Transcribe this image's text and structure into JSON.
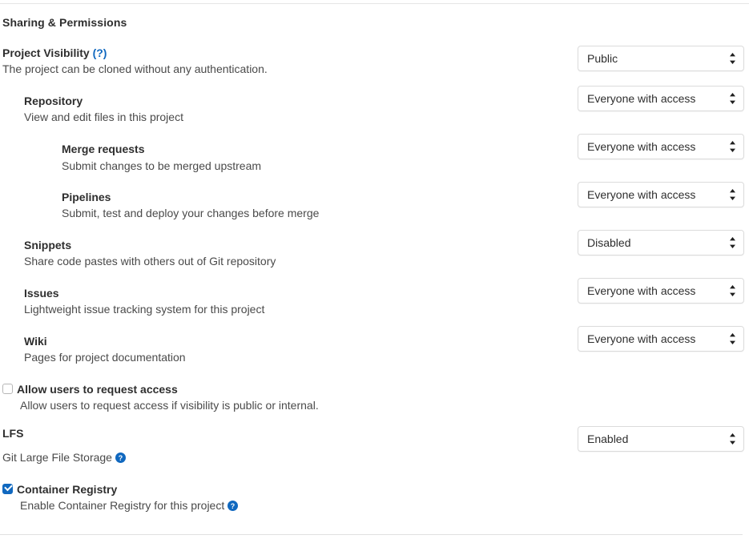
{
  "section": {
    "title": "Sharing & Permissions"
  },
  "visibility": {
    "label": "Project Visibility",
    "help_link": "(?)",
    "description": "The project can be cloned without any authentication.",
    "select_value": "Public"
  },
  "features": [
    {
      "label": "Repository",
      "description": "View and edit files in this project",
      "select_value": "Everyone with access",
      "indent": 30
    },
    {
      "label": "Merge requests",
      "description": "Submit changes to be merged upstream",
      "select_value": "Everyone with access",
      "indent": 77
    },
    {
      "label": "Pipelines",
      "description": "Submit, test and deploy your changes before merge",
      "select_value": "Everyone with access",
      "indent": 77
    },
    {
      "label": "Snippets",
      "description": "Share code pastes with others out of Git repository",
      "select_value": "Disabled",
      "indent": 30
    },
    {
      "label": "Issues",
      "description": "Lightweight issue tracking system for this project",
      "select_value": "Everyone with access",
      "indent": 30
    },
    {
      "label": "Wiki",
      "description": "Pages for project documentation",
      "select_value": "Everyone with access",
      "indent": 30
    }
  ],
  "request_access": {
    "label": "Allow users to request access",
    "description": "Allow users to request access if visibility is public or internal.",
    "checked": false
  },
  "lfs": {
    "label": "LFS",
    "description": "Git Large File Storage",
    "help_icon": "help-circle-icon",
    "select_value": "Enabled"
  },
  "container_registry": {
    "label": "Container Registry",
    "description": "Enable Container Registry for this project",
    "help_icon": "help-circle-icon",
    "checked": true
  },
  "colors": {
    "link_blue": "#1068bf",
    "text": "#2e2e2e",
    "muted_text": "#4a4a4a",
    "border": "#dbdbdb",
    "rule": "#e5e5e5"
  }
}
